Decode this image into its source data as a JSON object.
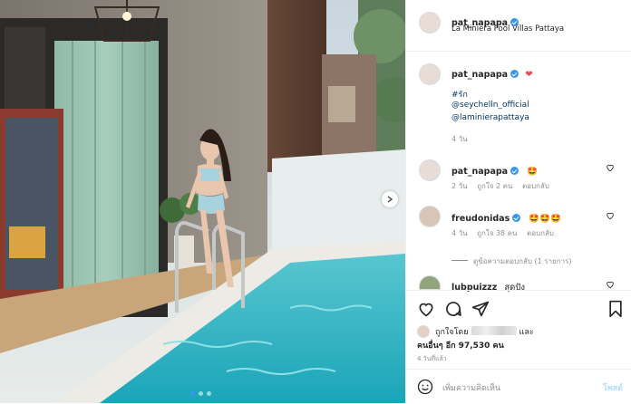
{
  "post": {
    "username": "pat_napapa",
    "location": "La Miniera Pool Villas Pattaya"
  },
  "caption": {
    "username": "pat_napapa",
    "emoji": "❤",
    "lines": [
      "#รัก",
      "@seychelln_official",
      "@laminierapattaya"
    ],
    "time": "4 วัน"
  },
  "comments": [
    {
      "username": "pat_napapa",
      "text": "🤩",
      "time": "2 วัน",
      "likes": "ถูกใจ 2 คน",
      "reply": "ตอบกลับ"
    },
    {
      "username": "freudonidas",
      "text": "🤩🤩🤩",
      "time": "4 วัน",
      "likes": "ถูกใจ 38 คน",
      "reply": "ตอบกลับ",
      "view_replies": "ดูข้อความตอบกลับ (1 รายการ)"
    },
    {
      "username": "lubpuizzz",
      "text": "สุดปัง"
    }
  ],
  "likes": {
    "prefix": "ถูกใจโดย",
    "suffix": "และ",
    "others": "คนอื่นๆ อีก 97,530 คน"
  },
  "posted_ago": "4 วันที่แล้ว",
  "add_comment": {
    "placeholder": "เพิ่มความคิดเห็น",
    "post_button": "โพสต์"
  },
  "icons": [
    "next-arrow-icon",
    "verified-icon",
    "heart-icon",
    "comment-icon",
    "share-icon",
    "bookmark-icon",
    "emoji-icon"
  ],
  "colors": {
    "accent": "#3897f0",
    "heart_red": "#ed4956",
    "link": "#00376b",
    "muted": "#8e8e8e"
  }
}
